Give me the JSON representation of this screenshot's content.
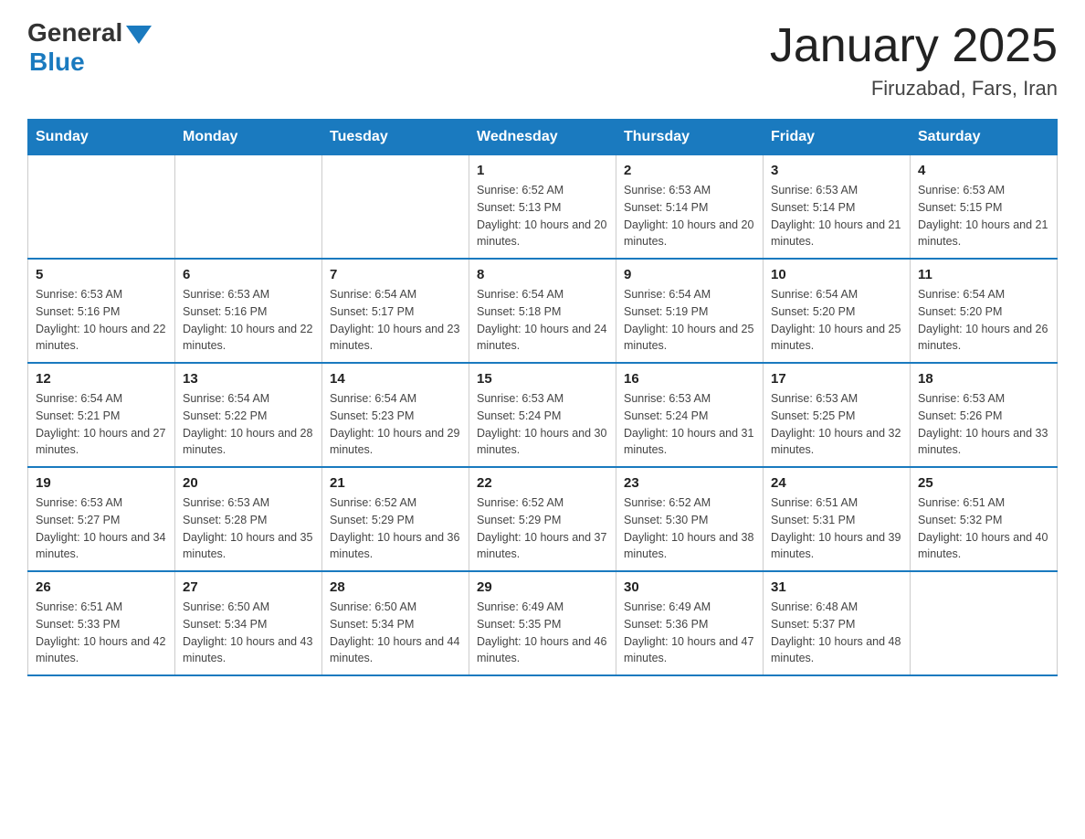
{
  "header": {
    "logo_general": "General",
    "logo_blue": "Blue",
    "month_title": "January 2025",
    "location": "Firuzabad, Fars, Iran"
  },
  "weekdays": [
    "Sunday",
    "Monday",
    "Tuesday",
    "Wednesday",
    "Thursday",
    "Friday",
    "Saturday"
  ],
  "weeks": [
    [
      {
        "day": "",
        "sunrise": "",
        "sunset": "",
        "daylight": ""
      },
      {
        "day": "",
        "sunrise": "",
        "sunset": "",
        "daylight": ""
      },
      {
        "day": "",
        "sunrise": "",
        "sunset": "",
        "daylight": ""
      },
      {
        "day": "1",
        "sunrise": "Sunrise: 6:52 AM",
        "sunset": "Sunset: 5:13 PM",
        "daylight": "Daylight: 10 hours and 20 minutes."
      },
      {
        "day": "2",
        "sunrise": "Sunrise: 6:53 AM",
        "sunset": "Sunset: 5:14 PM",
        "daylight": "Daylight: 10 hours and 20 minutes."
      },
      {
        "day": "3",
        "sunrise": "Sunrise: 6:53 AM",
        "sunset": "Sunset: 5:14 PM",
        "daylight": "Daylight: 10 hours and 21 minutes."
      },
      {
        "day": "4",
        "sunrise": "Sunrise: 6:53 AM",
        "sunset": "Sunset: 5:15 PM",
        "daylight": "Daylight: 10 hours and 21 minutes."
      }
    ],
    [
      {
        "day": "5",
        "sunrise": "Sunrise: 6:53 AM",
        "sunset": "Sunset: 5:16 PM",
        "daylight": "Daylight: 10 hours and 22 minutes."
      },
      {
        "day": "6",
        "sunrise": "Sunrise: 6:53 AM",
        "sunset": "Sunset: 5:16 PM",
        "daylight": "Daylight: 10 hours and 22 minutes."
      },
      {
        "day": "7",
        "sunrise": "Sunrise: 6:54 AM",
        "sunset": "Sunset: 5:17 PM",
        "daylight": "Daylight: 10 hours and 23 minutes."
      },
      {
        "day": "8",
        "sunrise": "Sunrise: 6:54 AM",
        "sunset": "Sunset: 5:18 PM",
        "daylight": "Daylight: 10 hours and 24 minutes."
      },
      {
        "day": "9",
        "sunrise": "Sunrise: 6:54 AM",
        "sunset": "Sunset: 5:19 PM",
        "daylight": "Daylight: 10 hours and 25 minutes."
      },
      {
        "day": "10",
        "sunrise": "Sunrise: 6:54 AM",
        "sunset": "Sunset: 5:20 PM",
        "daylight": "Daylight: 10 hours and 25 minutes."
      },
      {
        "day": "11",
        "sunrise": "Sunrise: 6:54 AM",
        "sunset": "Sunset: 5:20 PM",
        "daylight": "Daylight: 10 hours and 26 minutes."
      }
    ],
    [
      {
        "day": "12",
        "sunrise": "Sunrise: 6:54 AM",
        "sunset": "Sunset: 5:21 PM",
        "daylight": "Daylight: 10 hours and 27 minutes."
      },
      {
        "day": "13",
        "sunrise": "Sunrise: 6:54 AM",
        "sunset": "Sunset: 5:22 PM",
        "daylight": "Daylight: 10 hours and 28 minutes."
      },
      {
        "day": "14",
        "sunrise": "Sunrise: 6:54 AM",
        "sunset": "Sunset: 5:23 PM",
        "daylight": "Daylight: 10 hours and 29 minutes."
      },
      {
        "day": "15",
        "sunrise": "Sunrise: 6:53 AM",
        "sunset": "Sunset: 5:24 PM",
        "daylight": "Daylight: 10 hours and 30 minutes."
      },
      {
        "day": "16",
        "sunrise": "Sunrise: 6:53 AM",
        "sunset": "Sunset: 5:24 PM",
        "daylight": "Daylight: 10 hours and 31 minutes."
      },
      {
        "day": "17",
        "sunrise": "Sunrise: 6:53 AM",
        "sunset": "Sunset: 5:25 PM",
        "daylight": "Daylight: 10 hours and 32 minutes."
      },
      {
        "day": "18",
        "sunrise": "Sunrise: 6:53 AM",
        "sunset": "Sunset: 5:26 PM",
        "daylight": "Daylight: 10 hours and 33 minutes."
      }
    ],
    [
      {
        "day": "19",
        "sunrise": "Sunrise: 6:53 AM",
        "sunset": "Sunset: 5:27 PM",
        "daylight": "Daylight: 10 hours and 34 minutes."
      },
      {
        "day": "20",
        "sunrise": "Sunrise: 6:53 AM",
        "sunset": "Sunset: 5:28 PM",
        "daylight": "Daylight: 10 hours and 35 minutes."
      },
      {
        "day": "21",
        "sunrise": "Sunrise: 6:52 AM",
        "sunset": "Sunset: 5:29 PM",
        "daylight": "Daylight: 10 hours and 36 minutes."
      },
      {
        "day": "22",
        "sunrise": "Sunrise: 6:52 AM",
        "sunset": "Sunset: 5:29 PM",
        "daylight": "Daylight: 10 hours and 37 minutes."
      },
      {
        "day": "23",
        "sunrise": "Sunrise: 6:52 AM",
        "sunset": "Sunset: 5:30 PM",
        "daylight": "Daylight: 10 hours and 38 minutes."
      },
      {
        "day": "24",
        "sunrise": "Sunrise: 6:51 AM",
        "sunset": "Sunset: 5:31 PM",
        "daylight": "Daylight: 10 hours and 39 minutes."
      },
      {
        "day": "25",
        "sunrise": "Sunrise: 6:51 AM",
        "sunset": "Sunset: 5:32 PM",
        "daylight": "Daylight: 10 hours and 40 minutes."
      }
    ],
    [
      {
        "day": "26",
        "sunrise": "Sunrise: 6:51 AM",
        "sunset": "Sunset: 5:33 PM",
        "daylight": "Daylight: 10 hours and 42 minutes."
      },
      {
        "day": "27",
        "sunrise": "Sunrise: 6:50 AM",
        "sunset": "Sunset: 5:34 PM",
        "daylight": "Daylight: 10 hours and 43 minutes."
      },
      {
        "day": "28",
        "sunrise": "Sunrise: 6:50 AM",
        "sunset": "Sunset: 5:34 PM",
        "daylight": "Daylight: 10 hours and 44 minutes."
      },
      {
        "day": "29",
        "sunrise": "Sunrise: 6:49 AM",
        "sunset": "Sunset: 5:35 PM",
        "daylight": "Daylight: 10 hours and 46 minutes."
      },
      {
        "day": "30",
        "sunrise": "Sunrise: 6:49 AM",
        "sunset": "Sunset: 5:36 PM",
        "daylight": "Daylight: 10 hours and 47 minutes."
      },
      {
        "day": "31",
        "sunrise": "Sunrise: 6:48 AM",
        "sunset": "Sunset: 5:37 PM",
        "daylight": "Daylight: 10 hours and 48 minutes."
      },
      {
        "day": "",
        "sunrise": "",
        "sunset": "",
        "daylight": ""
      }
    ]
  ]
}
